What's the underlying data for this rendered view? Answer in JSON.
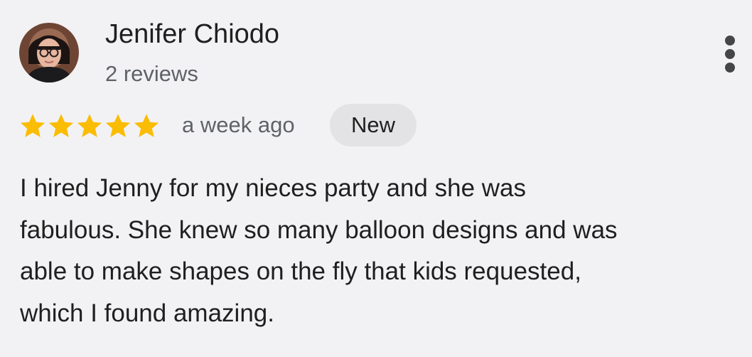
{
  "review": {
    "author": {
      "name": "Jenifer Chiodo",
      "review_count": "2 reviews",
      "avatar_icon": "profile-photo"
    },
    "rating": 5,
    "max_rating": 5,
    "time": "a week ago",
    "badge": "New",
    "text": "I hired Jenny for my nieces party and she was\nfabulous. She knew so many balloon designs and was\nable to make shapes on the fly that kids requested,\nwhich I found amazing."
  },
  "menu": {
    "icon": "more-vertical-icon"
  },
  "colors": {
    "background": "#f2f2f4",
    "star": "#fbbc04",
    "text_primary": "#1f1f1f",
    "text_secondary": "#5f6368",
    "badge_background": "#e3e3e5"
  }
}
